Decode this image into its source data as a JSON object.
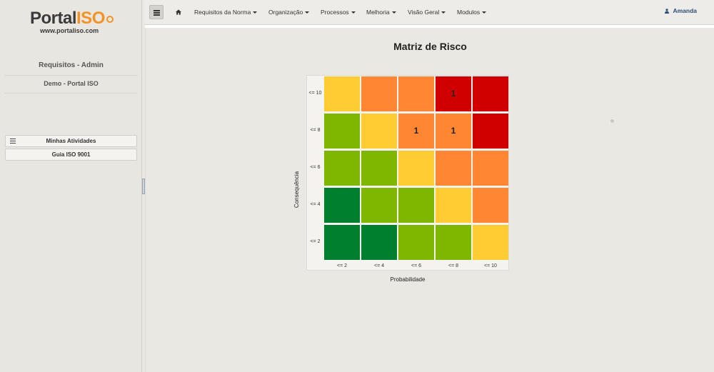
{
  "logo": {
    "main": "Portal",
    "accent": "ISO",
    "sub": "www.portaliso.com"
  },
  "sidebar": {
    "title": "Requisitos - Admin",
    "subtitle": "Demo - Portal ISO",
    "buttons": [
      {
        "label": "Minhas Atividades",
        "icon": "list-icon"
      },
      {
        "label": "Guia ISO 9001"
      }
    ]
  },
  "topbar": {
    "menu_icon": "hamburger-icon",
    "home_icon": "home-icon",
    "nav": [
      {
        "label": "Requisitos da Norma"
      },
      {
        "label": "Organização"
      },
      {
        "label": "Processos"
      },
      {
        "label": "Melhoria"
      },
      {
        "label": "Visão Geral"
      },
      {
        "label": "Modulos"
      }
    ],
    "user": {
      "name": "Amanda",
      "icon": "user-icon"
    }
  },
  "main": {
    "title": "Matriz de Risco",
    "y_axis_label": "Consequência",
    "x_axis_label": "Probabilidade",
    "row_labels": [
      "<= 10",
      "<= 8",
      "<= 6",
      "<= 4",
      "<= 2"
    ],
    "col_labels": [
      "<= 2",
      "<= 4",
      "<= 6",
      "<= 8",
      "<= 10"
    ],
    "colors": {
      "dark_green": "#00802f",
      "green": "#7fb600",
      "yellow": "#ffcd33",
      "orange": "#ff8633",
      "red": "#d10000"
    },
    "grid": [
      [
        {
          "c": "yellow",
          "v": ""
        },
        {
          "c": "orange",
          "v": ""
        },
        {
          "c": "orange",
          "v": ""
        },
        {
          "c": "red",
          "v": "1"
        },
        {
          "c": "red",
          "v": ""
        }
      ],
      [
        {
          "c": "green",
          "v": ""
        },
        {
          "c": "yellow",
          "v": ""
        },
        {
          "c": "orange",
          "v": "1"
        },
        {
          "c": "orange",
          "v": "1"
        },
        {
          "c": "red",
          "v": ""
        }
      ],
      [
        {
          "c": "green",
          "v": ""
        },
        {
          "c": "green",
          "v": ""
        },
        {
          "c": "yellow",
          "v": ""
        },
        {
          "c": "orange",
          "v": ""
        },
        {
          "c": "orange",
          "v": ""
        }
      ],
      [
        {
          "c": "dark_green",
          "v": ""
        },
        {
          "c": "green",
          "v": ""
        },
        {
          "c": "green",
          "v": ""
        },
        {
          "c": "yellow",
          "v": ""
        },
        {
          "c": "orange",
          "v": ""
        }
      ],
      [
        {
          "c": "dark_green",
          "v": ""
        },
        {
          "c": "dark_green",
          "v": ""
        },
        {
          "c": "green",
          "v": ""
        },
        {
          "c": "green",
          "v": ""
        },
        {
          "c": "yellow",
          "v": ""
        }
      ]
    ]
  }
}
